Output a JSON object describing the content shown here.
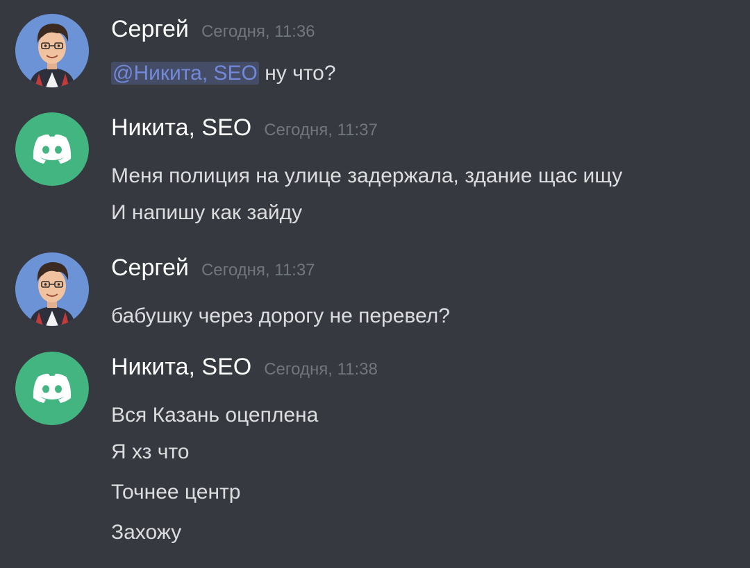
{
  "colors": {
    "background": "#36393f",
    "text": "#dcddde",
    "author": "#ffffff",
    "timestamp": "#72767d",
    "mention_text": "#7289da",
    "discord_green": "#43b581"
  },
  "messages": [
    {
      "author": "Сергей",
      "time": "Сегодня, 11:36",
      "avatar": "memoji-avatar",
      "mention": "@Никита, SEO",
      "text_after_mention": " ну что?"
    },
    {
      "author": "Никита, SEO",
      "time": "Сегодня, 11:37",
      "avatar": "discord-logo-icon",
      "lines": [
        "Меня полиция на улице задержала, здание щас ищу",
        "И напишу как зайду"
      ]
    },
    {
      "author": "Сергей",
      "time": "Сегодня, 11:37",
      "avatar": "memoji-avatar",
      "lines": [
        "бабушку через дорогу не перевел?"
      ]
    },
    {
      "author": "Никита, SEO",
      "time": "Сегодня, 11:38",
      "avatar": "discord-logo-icon",
      "lines": [
        "Вся Казань оцеплена",
        "Я хз что",
        "Точнее центр",
        "Захожу"
      ]
    }
  ]
}
